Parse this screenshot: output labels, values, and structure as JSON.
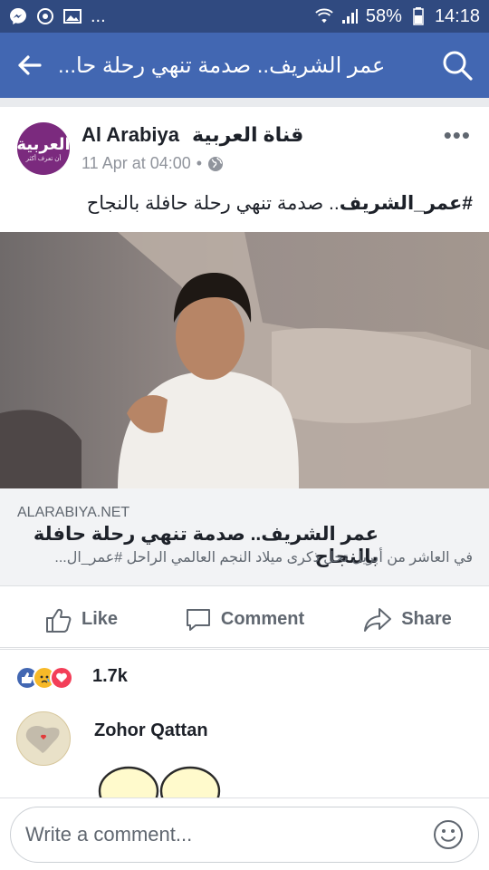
{
  "status": {
    "left_icons": [
      "messenger-icon",
      "sync-icon",
      "image-icon"
    ],
    "left_more": "...",
    "battery": "58%",
    "time": "14:18"
  },
  "topbar": {
    "title": "عمر الشريف.. صدمة تنهي رحلة حا...",
    "back_icon": "arrow-left-icon",
    "search_icon": "search-icon"
  },
  "post": {
    "page_name": "Al Arabiya",
    "page_name_ar": "قناة العربية",
    "avatar_text": "العربية",
    "avatar_sub": "أن تعرف أكثر",
    "timestamp": "11 Apr at 04:00",
    "dot": "•",
    "privacy_icon": "globe-icon",
    "more_label": "•••",
    "text_hashtag": "#عمر_الشريف",
    "text_rest": ".. صدمة تنهي رحلة حافلة بالنجاح"
  },
  "link": {
    "domain": "ALARABIYA.NET",
    "title": "عمر الشريف.. صدمة تنهي رحلة حافلة بالنجاح",
    "description": "في العاشر من أبريل تحل ذكرى ميلاد النجم العالمي الراحل #عمر_ال..."
  },
  "actions": [
    {
      "label": "Like",
      "icon": "thumbs-up-icon"
    },
    {
      "label": "Comment",
      "icon": "comment-icon"
    },
    {
      "label": "Share",
      "icon": "share-icon"
    }
  ],
  "reactions": {
    "icons": [
      "like-reaction-icon",
      "sad-reaction-icon",
      "love-reaction-icon"
    ],
    "count": "1.7k"
  },
  "comment": {
    "author": "Zohor Qattan"
  },
  "composer": {
    "placeholder": "Write a comment...",
    "emoji_icon": "smiley-icon"
  },
  "colors": {
    "brand": "#4267b2",
    "status_bar": "#304a80",
    "avatar_bg": "#7b2a7e"
  }
}
